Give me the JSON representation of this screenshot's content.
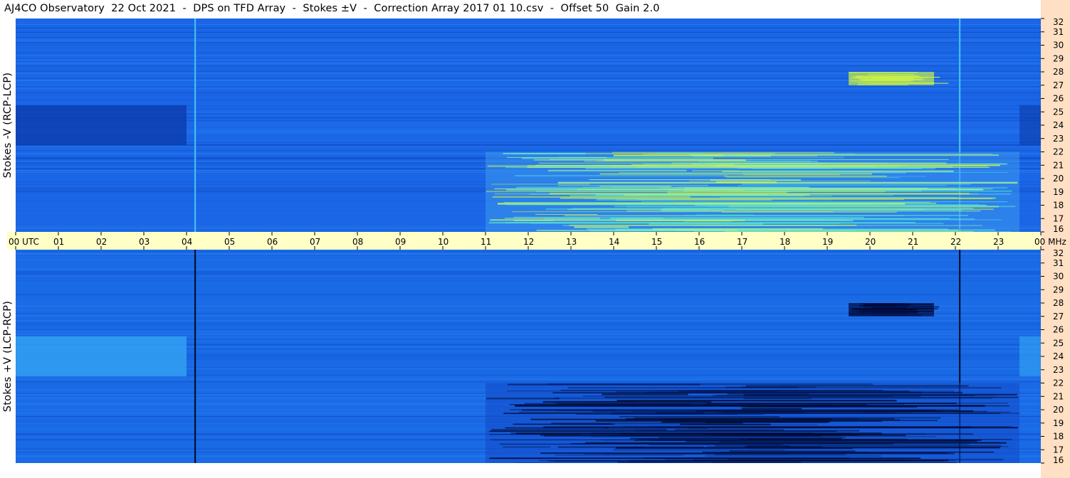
{
  "title": "AJ4CO Observatory  22 Oct 2021  -  DPS on TFD Array  -  Stokes ±V  -  Correction Array 2017 01 10.csv  -  Offset 50  Gain 2.0",
  "chart_data": [
    {
      "type": "heatmap",
      "panel": "top",
      "ylabel": "Stokes -V (RCP-LCP)",
      "y_unit": "MHz",
      "ylim": [
        16,
        32
      ],
      "y_ticks": [
        "32",
        "31",
        "30",
        "29",
        "28",
        "27",
        "26",
        "25",
        "24",
        "23",
        "22",
        "21",
        "20",
        "19",
        "18",
        "17",
        "16"
      ],
      "xlim_utc_hours": [
        0,
        24
      ],
      "background_color": "#1a66e6",
      "burst_color": "#c8f04a",
      "features": [
        {
          "kind": "dark band",
          "freq_mhz": 24,
          "utc_start": 0,
          "utc_end": 4
        },
        {
          "kind": "vertical line",
          "utc": 4.2,
          "color": "#3fc0f0"
        },
        {
          "kind": "vertical line",
          "utc": 22.1,
          "color": "#3fc0f0"
        },
        {
          "kind": "emission region",
          "utc_start": 11,
          "utc_end": 23.5,
          "freq_start": 16,
          "freq_end": 22
        },
        {
          "kind": "burst",
          "utc_start": 19.5,
          "utc_end": 21.5,
          "freq_mhz": 27.5
        }
      ]
    },
    {
      "type": "heatmap",
      "panel": "bottom",
      "ylabel": "Stokes +V (LCP-RCP)",
      "y_unit": "MHz",
      "ylim": [
        16,
        32
      ],
      "y_ticks": [
        "32",
        "31",
        "30",
        "29",
        "28",
        "27",
        "26",
        "25",
        "24",
        "23",
        "22",
        "21",
        "20",
        "19",
        "18",
        "17",
        "16"
      ],
      "xlim_utc_hours": [
        0,
        24
      ],
      "background_color": "#1a6ae6",
      "burst_color": "#000a3c",
      "features": [
        {
          "kind": "bright band",
          "freq_mhz": 24,
          "utc_start": 0,
          "utc_end": 4
        },
        {
          "kind": "vertical line",
          "utc": 4.2,
          "color": "#001030"
        },
        {
          "kind": "vertical line",
          "utc": 22.1,
          "color": "#001030"
        },
        {
          "kind": "absorption region",
          "utc_start": 11,
          "utc_end": 23.5,
          "freq_start": 16,
          "freq_end": 22
        },
        {
          "kind": "burst",
          "utc_start": 19.5,
          "utc_end": 21.5,
          "freq_mhz": 27.5
        }
      ]
    }
  ],
  "time_axis": {
    "labels": [
      "00 UTC",
      "01",
      "02",
      "03",
      "04",
      "05",
      "06",
      "07",
      "08",
      "09",
      "10",
      "11",
      "12",
      "13",
      "14",
      "15",
      "16",
      "17",
      "18",
      "19",
      "20",
      "21",
      "22",
      "23",
      "00 MHz"
    ],
    "band_color": "#ffffc6"
  },
  "colors": {
    "right_strip": "#ffe0c4",
    "time_band": "#ffffc6"
  }
}
